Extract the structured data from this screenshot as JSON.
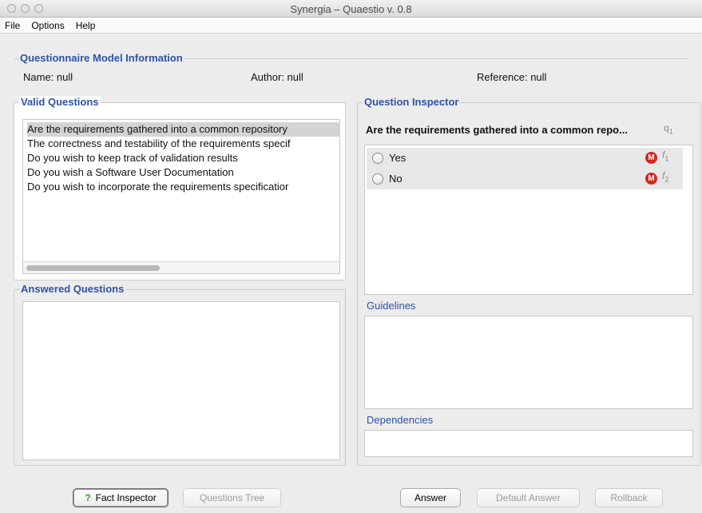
{
  "window": {
    "title": "Synergia – Quaestio v. 0.8"
  },
  "menu": [
    "File",
    "Options",
    "Help"
  ],
  "model_info": {
    "legend": "Questionnaire Model Information",
    "name": "Name: null",
    "author": "Author: null",
    "reference": "Reference: null"
  },
  "valid_questions": {
    "legend": "Valid Questions",
    "items": [
      "Are the requirements gathered into a common repository",
      "The correctness and testability of the requirements specif",
      "Do you wish to keep track of validation results",
      "Do you wish a Software User Documentation",
      "Do you wish to incorporate the requirements specificatior"
    ],
    "selected_index": 0
  },
  "answered_questions": {
    "legend": "Answered Questions",
    "items": []
  },
  "inspector": {
    "legend": "Question Inspector",
    "question": "Are the requirements gathered into a common repo...",
    "qid_letter": "q",
    "qid_index": "1",
    "answers": [
      {
        "label": "Yes",
        "badge": "M",
        "fact_letter": "f",
        "fact_index": "1"
      },
      {
        "label": "No",
        "badge": "M",
        "fact_letter": "f",
        "fact_index": "2"
      }
    ],
    "guidelines_label": "Guidelines",
    "dependencies_label": "Dependencies"
  },
  "buttons": {
    "fact_inspector": "Fact Inspector",
    "fact_inspector_icon": "?",
    "questions_tree": "Questions Tree",
    "answer": "Answer",
    "default_answer": "Default Answer",
    "rollback": "Rollback"
  },
  "colors": {
    "legend": "#2f53a3",
    "badge": "#d6261f",
    "help_icon": "#3b9a2c"
  }
}
